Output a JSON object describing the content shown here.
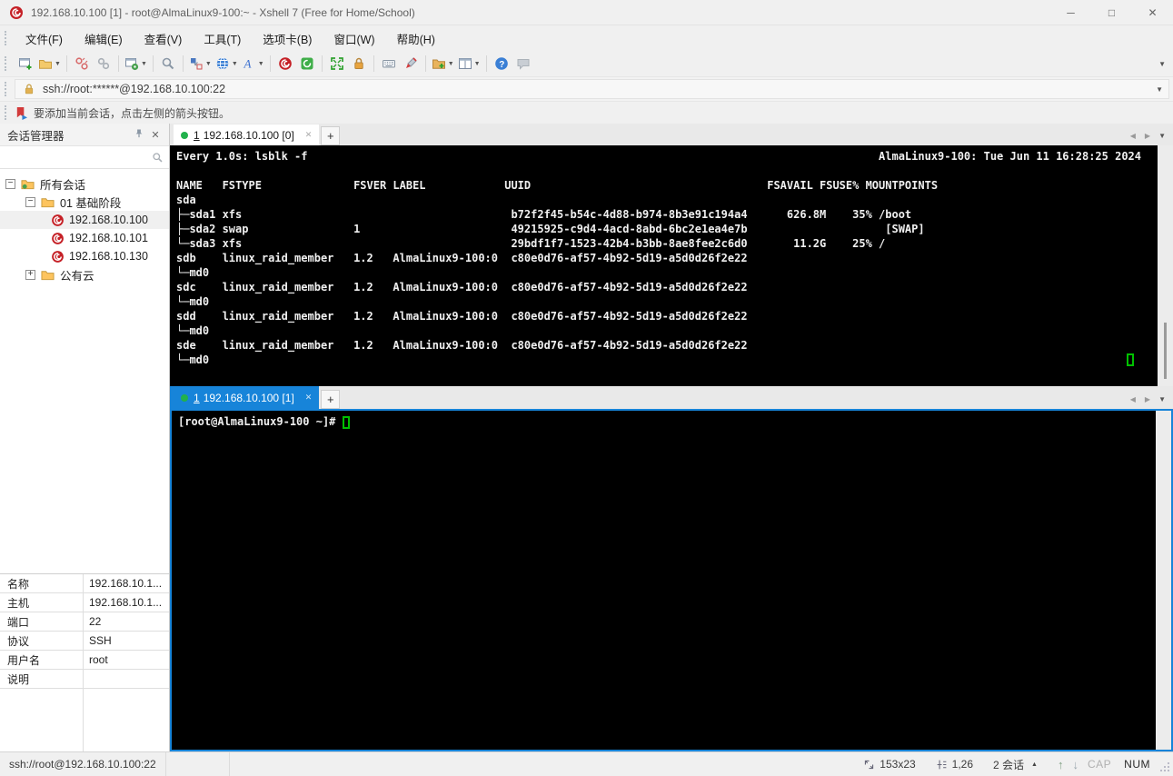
{
  "window": {
    "title": "192.168.10.100 [1] - root@AlmaLinux9-100:~ - Xshell 7 (Free for Home/School)",
    "minimize": "─",
    "maximize": "□",
    "close": "✕"
  },
  "menu": {
    "items": [
      {
        "label": "文件(F)"
      },
      {
        "label": "编辑(E)"
      },
      {
        "label": "查看(V)"
      },
      {
        "label": "工具(T)"
      },
      {
        "label": "选项卡(B)"
      },
      {
        "label": "窗口(W)"
      },
      {
        "label": "帮助(H)"
      }
    ]
  },
  "toolbar": {
    "icons": [
      "new-session-icon",
      "open-folder-icon",
      "disconnect-icon",
      "reconnect-icon",
      "session-properties-icon",
      "find-icon",
      "layout-icon",
      "web-icon",
      "font-icon",
      "xshell-icon",
      "xftp-icon",
      "fullscreen-icon",
      "lock-screen-icon",
      "virtual-keyboard-icon",
      "highlight-icon",
      "new-tab-group-icon",
      "tile-windows-icon",
      "help-icon",
      "feedback-icon",
      "overflow-icon"
    ],
    "caret": "▼",
    "overflow": "▼"
  },
  "address_bar": {
    "value": "ssh://root:******@192.168.10.100:22",
    "caret": "▼"
  },
  "hint_bar": {
    "text": "要添加当前会话，点击左侧的箭头按钮。"
  },
  "session_manager": {
    "title": "会话管理器",
    "pin": "⊥",
    "close": "✕",
    "search_value": "",
    "tree": {
      "root": "所有会话",
      "group": "01 基础阶段",
      "sessions": [
        "192.168.10.100",
        "192.168.10.101",
        "192.168.10.130"
      ],
      "group2": "公有云",
      "collapse": "−",
      "expand": "+"
    },
    "properties": [
      {
        "label": "名称",
        "value": "192.168.10.1..."
      },
      {
        "label": "主机",
        "value": "192.168.10.1..."
      },
      {
        "label": "端口",
        "value": "22"
      },
      {
        "label": "协议",
        "value": "SSH"
      },
      {
        "label": "用户名",
        "value": "root"
      },
      {
        "label": "说明",
        "value": ""
      }
    ]
  },
  "panes": {
    "tab_nav": {
      "prev": "◀",
      "next": "▶",
      "menu": "▼"
    },
    "top": {
      "tab_index": "1",
      "tab_label": "192.168.10.100 [0]",
      "close": "✕",
      "new_tab": "+",
      "watch_left": "Every 1.0s: lsblk -f",
      "watch_right": "AlmaLinux9-100: Tue Jun 11 16:28:25 2024",
      "body": "NAME   FSTYPE              FSVER LABEL            UUID                                    FSAVAIL FSUSE% MOUNTPOINTS\nsda\n├─sda1 xfs                                         b72f2f45-b54c-4d88-b974-8b3e91c194a4      626.8M    35% /boot\n├─sda2 swap                1                       49215925-c9d4-4acd-8abd-6bc2e1ea4e7b                     [SWAP]\n└─sda3 xfs                                         29bdf1f7-1523-42b4-b3bb-8ae8fee2c6d0       11.2G    25% /\nsdb    linux_raid_member   1.2   AlmaLinux9-100:0  c80e0d76-af57-4b92-5d19-a5d0d26f2e22\n└─md0\nsdc    linux_raid_member   1.2   AlmaLinux9-100:0  c80e0d76-af57-4b92-5d19-a5d0d26f2e22\n└─md0\nsdd    linux_raid_member   1.2   AlmaLinux9-100:0  c80e0d76-af57-4b92-5d19-a5d0d26f2e22\n└─md0\nsde    linux_raid_member   1.2   AlmaLinux9-100:0  c80e0d76-af57-4b92-5d19-a5d0d26f2e22\n└─md0"
    },
    "bottom": {
      "tab_index": "1",
      "tab_label": "192.168.10.100 [1]",
      "close": "✕",
      "new_tab": "+",
      "prompt": "[root@AlmaLinux9-100 ~]# "
    }
  },
  "status_bar": {
    "connection": "ssh://root@192.168.10.100:22",
    "terminal_size": "153x23",
    "cursor_position": "1,26",
    "sessions": "2 会话",
    "sessions_caret": "▲",
    "arrow_up": "↑",
    "arrow_down": "↓",
    "caps": "CAP",
    "num": "NUM"
  },
  "colors": {
    "accent_blue": "#1784d9",
    "terminal_bg": "#000000",
    "terminal_fg": "#f0f0f0",
    "cursor_green": "#00c000",
    "tab_dot_green": "#22b14c",
    "session_icon_red": "#c52026",
    "folder_yellow": "#fdc45e"
  }
}
